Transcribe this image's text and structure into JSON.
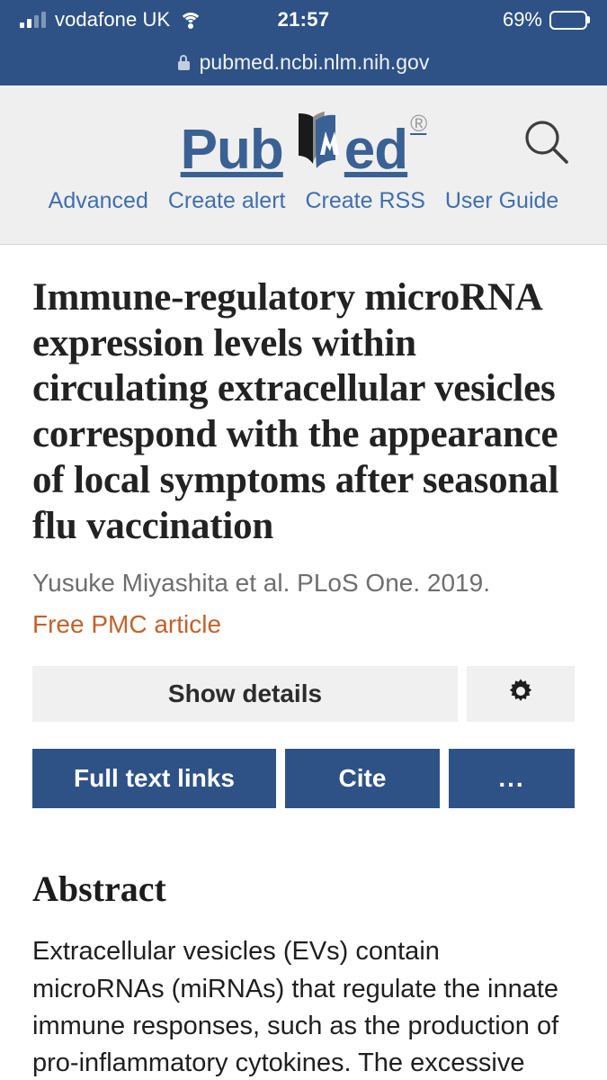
{
  "status_bar": {
    "carrier": "vodafone UK",
    "time": "21:57",
    "battery_percent": "69%",
    "signal_icon": "signal-bars-icon",
    "wifi_icon": "wifi-icon",
    "battery_icon": "battery-icon",
    "battery_fill_ratio": 0.69
  },
  "url_bar": {
    "url": "pubmed.ncbi.nlm.nih.gov",
    "lock_icon": "lock-icon"
  },
  "header": {
    "logo": {
      "part1": "Pub",
      "part2": "ed",
      "registered_mark": "®",
      "book_icon": "open-book-icon"
    },
    "search_icon": "search-icon",
    "nav_links": [
      {
        "label": "Advanced"
      },
      {
        "label": "Create alert"
      },
      {
        "label": "Create RSS"
      },
      {
        "label": "User Guide"
      }
    ]
  },
  "article": {
    "title": "Immune-regulatory microRNA expression levels within circulating extracellular vesicles correspond with the appearance of local symptoms after seasonal flu vaccination",
    "citation": "Yusuke Miyashita et al. PLoS One. 2019.",
    "free_tag": "Free PMC article",
    "show_details_label": "Show details",
    "gear_icon": "gear-icon",
    "full_text_links_label": "Full text links",
    "cite_label": "Cite",
    "more_label": "...",
    "abstract_heading": "Abstract",
    "abstract_text": "Extracellular vesicles (EVs) contain microRNAs (miRNAs) that regulate the innate immune responses, such as the production of pro-inflammatory cytokines. The excessive"
  },
  "colors": {
    "chrome_blue": "#2E5285",
    "header_gray": "#EFEFEF",
    "link_blue": "#3E6FAF",
    "logo_blue": "#3A6194",
    "free_orange": "#C1622D",
    "button_blue": "#2E5285",
    "button_gray": "#F0F0F0"
  }
}
